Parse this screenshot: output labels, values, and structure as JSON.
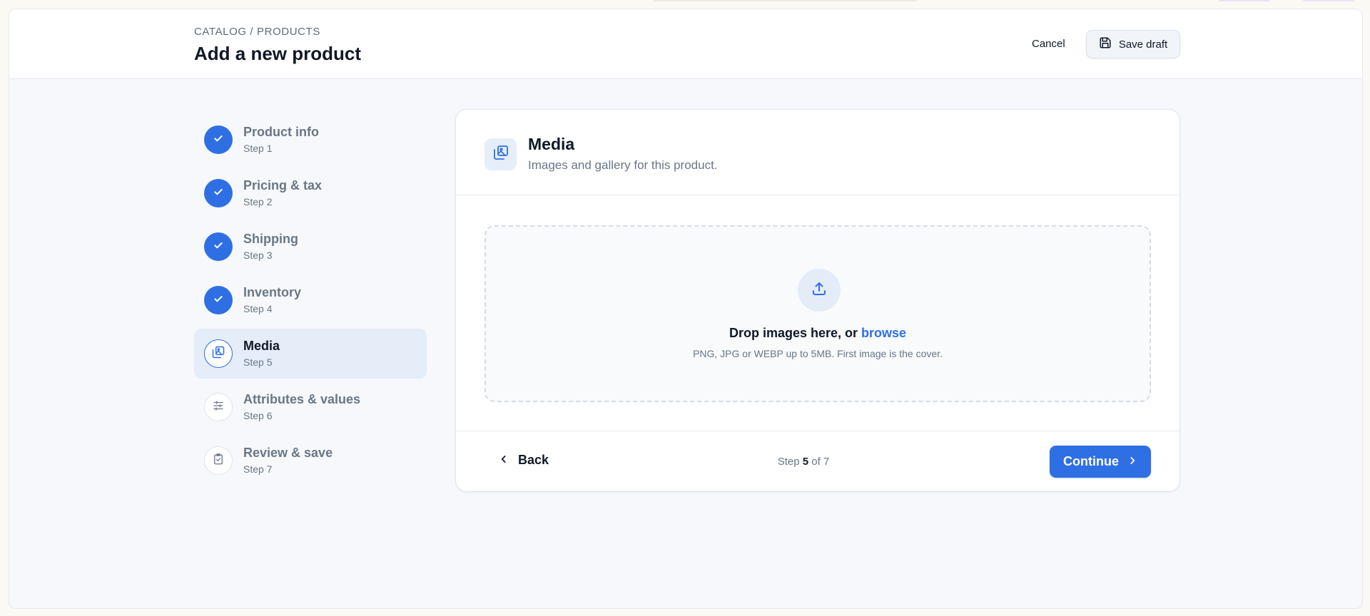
{
  "colors": {
    "accent": "#2f6fe4",
    "active_step_bg": "#e4edf8",
    "page_bg": "#f6f8fb"
  },
  "header": {
    "breadcrumb": "CATALOG / PRODUCTS",
    "title": "Add a new product",
    "cancel_label": "Cancel",
    "save_draft_label": "Save draft",
    "save_draft_icon": "floppy-disk-icon"
  },
  "steps": [
    {
      "title": "Product info",
      "sub": "Step 1",
      "status": "done",
      "icon": "check-icon"
    },
    {
      "title": "Pricing & tax",
      "sub": "Step 2",
      "status": "done",
      "icon": "check-icon"
    },
    {
      "title": "Shipping",
      "sub": "Step 3",
      "status": "done",
      "icon": "check-icon"
    },
    {
      "title": "Inventory",
      "sub": "Step 4",
      "status": "done",
      "icon": "check-icon"
    },
    {
      "title": "Media",
      "sub": "Step 5",
      "status": "current",
      "icon": "images-icon"
    },
    {
      "title": "Attributes & values",
      "sub": "Step 6",
      "status": "todo",
      "icon": "sliders-icon"
    },
    {
      "title": "Review & save",
      "sub": "Step 7",
      "status": "todo",
      "icon": "clipboard-check-icon"
    }
  ],
  "card": {
    "icon": "images-icon",
    "title": "Media",
    "subtitle": "Images and gallery for this product.",
    "dropzone": {
      "icon": "upload-icon",
      "text": "Drop images here, or ",
      "link": "browse",
      "hint": "PNG, JPG or WEBP up to 5MB. First image is the cover."
    },
    "footer": {
      "back_label": "Back",
      "step_prefix": "Step ",
      "step_current": "5",
      "step_suffix": " of 7",
      "continue_label": "Continue"
    }
  }
}
